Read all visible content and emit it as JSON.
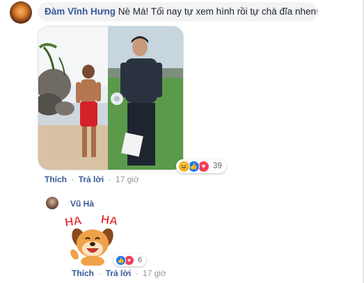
{
  "comment": {
    "author": "Đàm Vĩnh Hưng",
    "text": " Nè Má! Tối nay tự xem hình rồi tự chà đĩa nhen!",
    "reactions": {
      "icons": [
        "haha-icon",
        "like-icon",
        "love-icon"
      ],
      "count": "39"
    },
    "actions": {
      "like": "Thích",
      "reply": "Trả lời",
      "time": "17 giờ",
      "separator": "·"
    }
  },
  "reply": {
    "author": "Vũ Hà",
    "sticker_text": {
      "left": "HA",
      "right": "HA"
    },
    "reactions": {
      "icons": [
        "like-icon",
        "love-icon"
      ],
      "count": "6"
    },
    "actions": {
      "like": "Thích",
      "reply": "Trả lời",
      "time": "17 giờ",
      "separator": "·"
    }
  },
  "colors": {
    "link": "#385898",
    "bubble": "#f2f3f5",
    "meta": "#90949c",
    "like": "#1877f2",
    "love": "#f33e58",
    "haha": "#f7b125"
  }
}
